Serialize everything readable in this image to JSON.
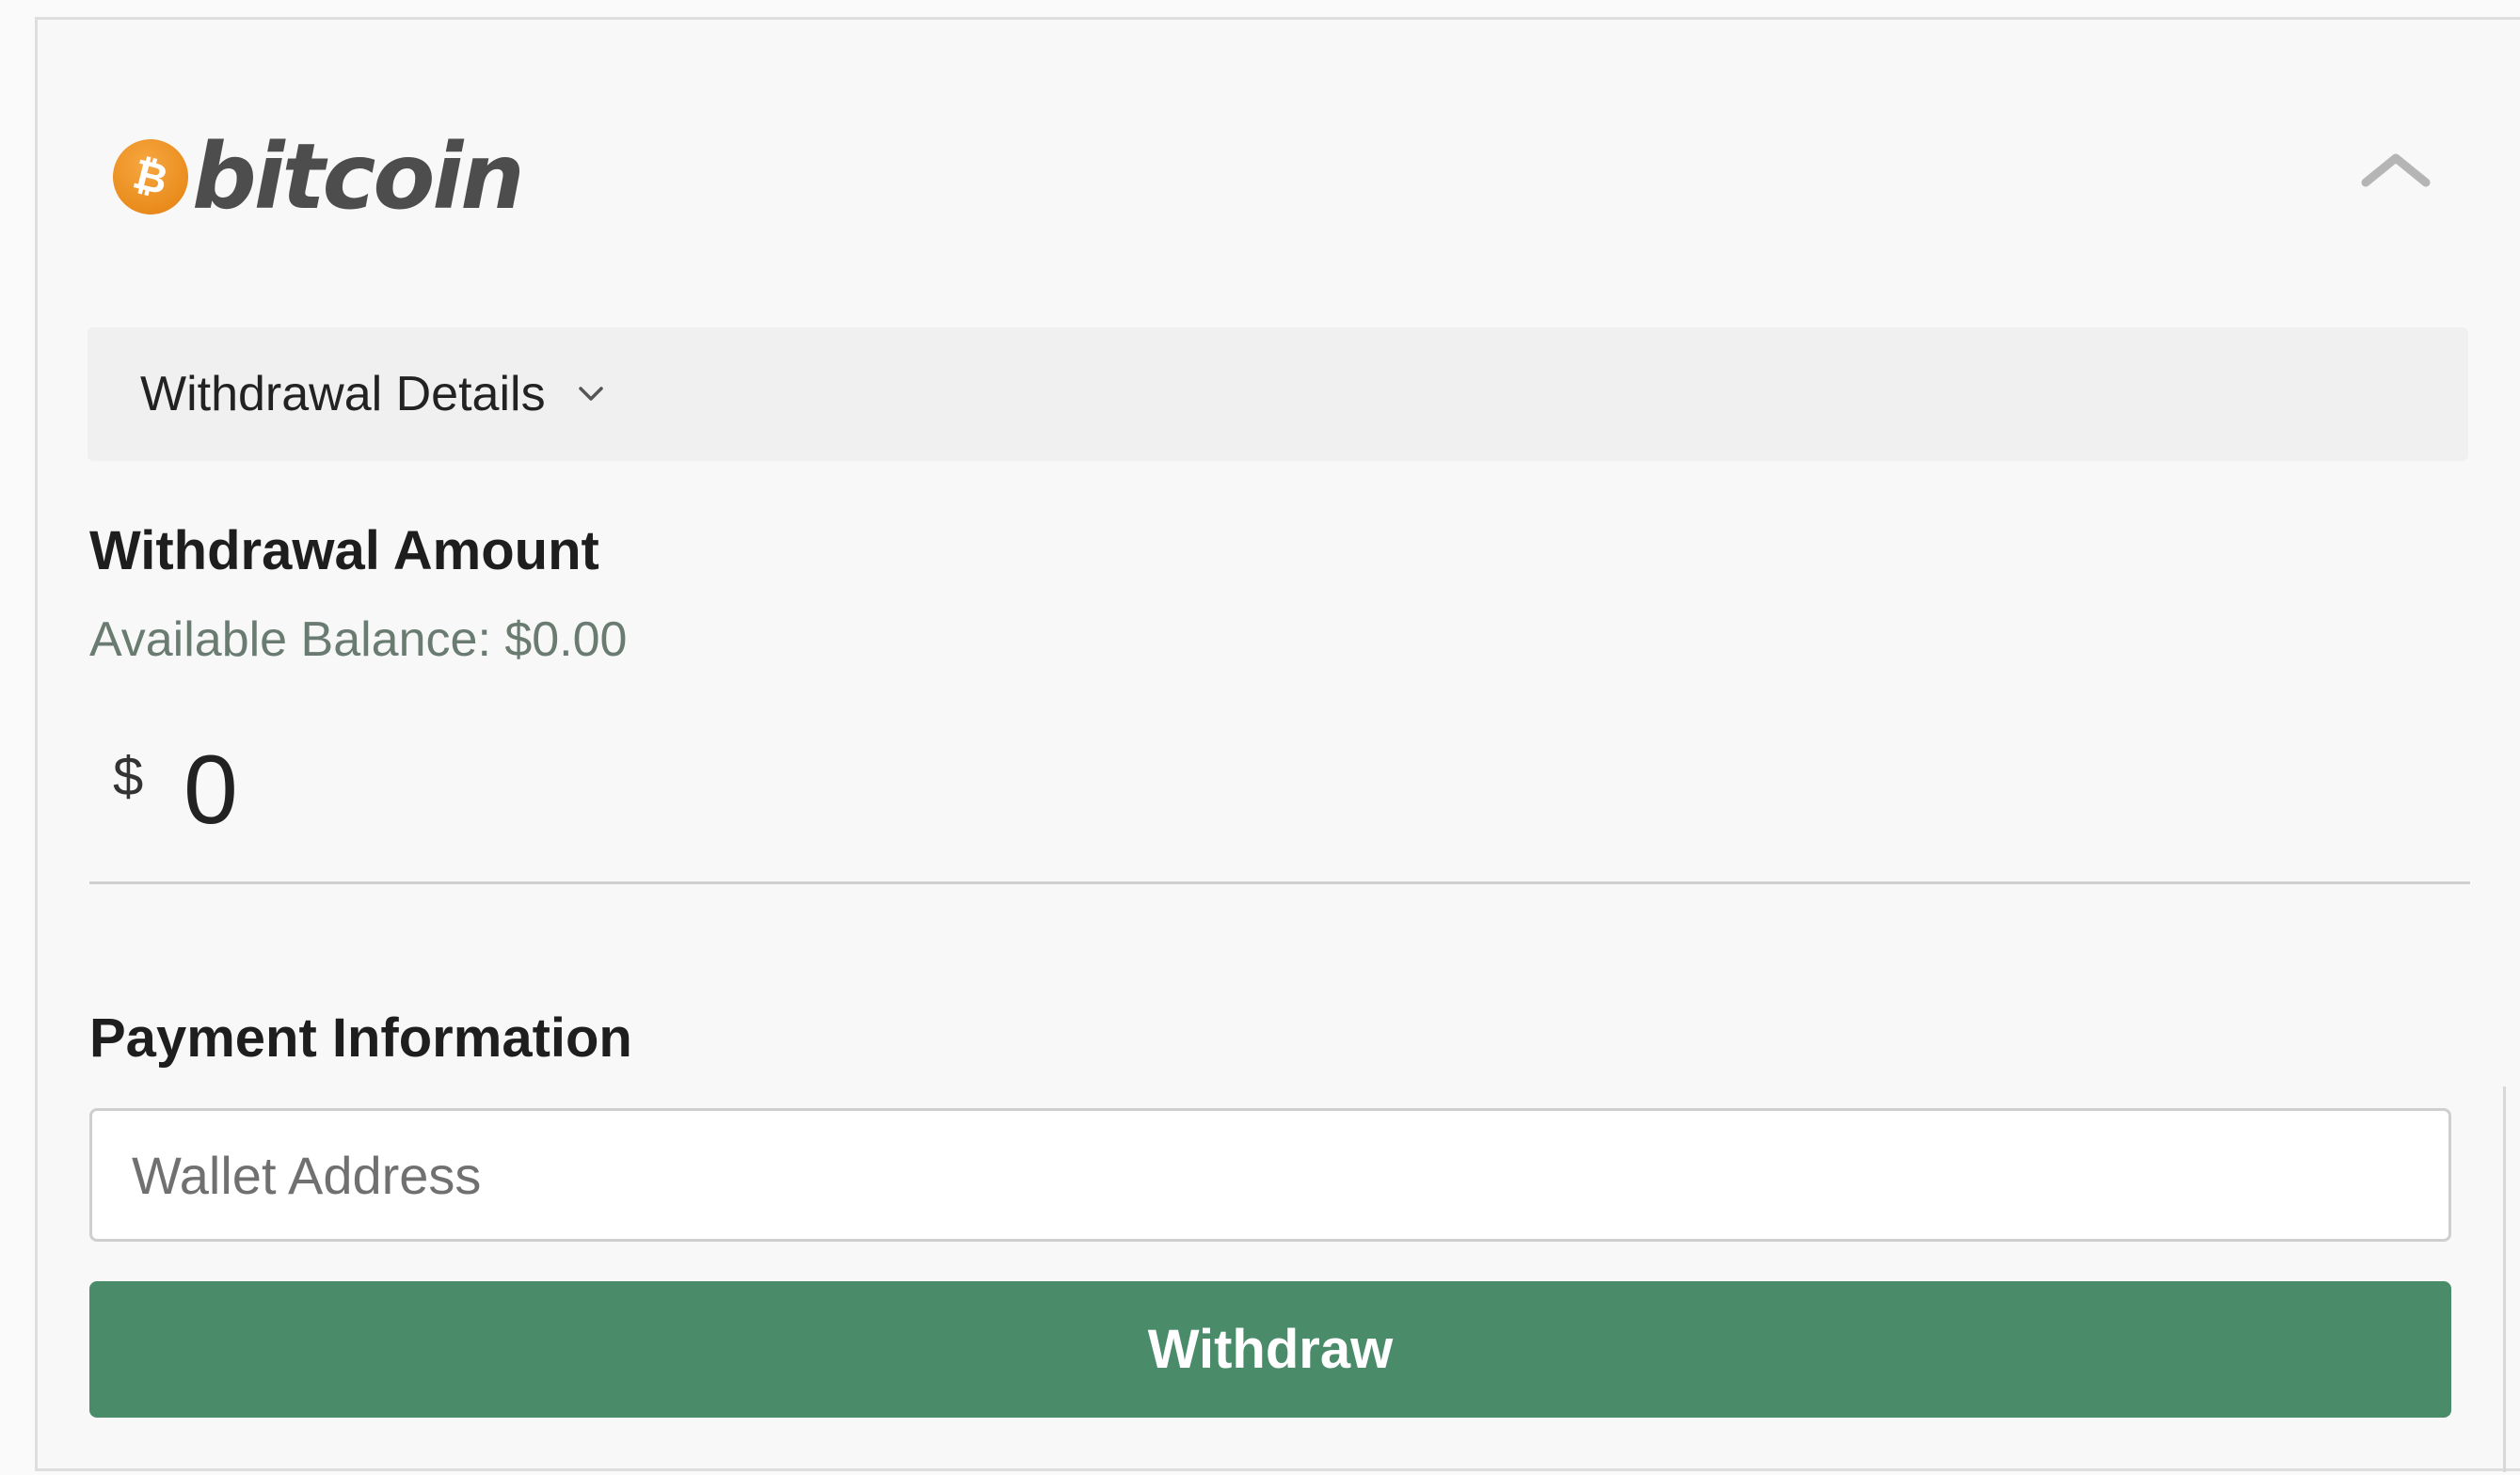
{
  "brand": {
    "coin_symbol": "₿",
    "name": "bitcoin",
    "coin_color": "#ea8c1d"
  },
  "header": {
    "collapse_icon": "chevron-up-icon"
  },
  "details": {
    "label": "Withdrawal Details",
    "toggle_icon": "chevron-down-icon"
  },
  "withdrawal": {
    "heading": "Withdrawal Amount",
    "available_balance": "Available Balance: $0.00",
    "currency_symbol": "$",
    "amount_value": "0"
  },
  "payment": {
    "heading": "Payment Information",
    "wallet_placeholder": "Wallet Address",
    "wallet_value": ""
  },
  "actions": {
    "withdraw_label": "Withdraw",
    "withdraw_color": "#4a8b6a"
  }
}
